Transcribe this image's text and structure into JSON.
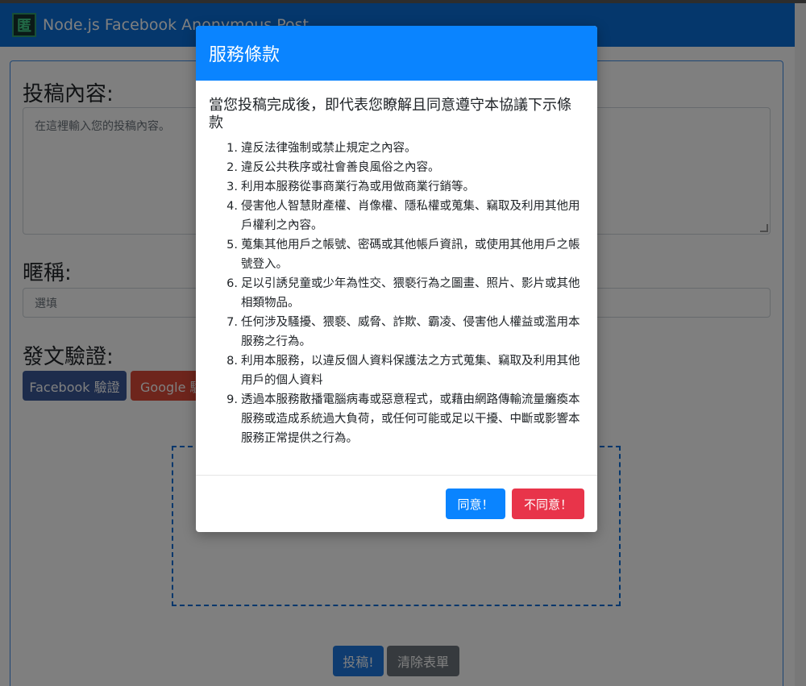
{
  "navbar": {
    "brand_icon_glyph": "匿",
    "brand": "Node.js Facebook Anonymous Post"
  },
  "form": {
    "content_label": "投稿內容:",
    "content_placeholder": "在這裡輸入您的投稿內容。",
    "nickname_label": "暱稱:",
    "nickname_placeholder": "選填",
    "verify_label": "發文驗證:",
    "facebook_button": "Facebook 驗證",
    "google_button": "Google 驗證",
    "post_button": "投稿!",
    "clear_button": "清除表單"
  },
  "modal": {
    "title": "服務條款",
    "intro": "當您投稿完成後，即代表您瞭解且同意遵守本協議下示條款",
    "terms": [
      {
        "num": "1.",
        "text": "違反法律強制或禁止規定之內容。"
      },
      {
        "num": "2.",
        "text": "違反公共秩序或社會善良風俗之內容。"
      },
      {
        "num": "3.",
        "text": "利用本服務從事商業行為或用做商業行銷等。"
      },
      {
        "num": "4.",
        "text": "侵害他人智慧財產權、肖像權、隱私權或蒐集、竊取及利用其他用戶權利之內容。"
      },
      {
        "num": "5.",
        "text": "蒐集其他用戶之帳號、密碼或其他帳戶資訊，或使用其他用戶之帳號登入。"
      },
      {
        "num": "6.",
        "text": "足以引誘兒童或少年為性交、猥褻行為之圖畫、照片、影片或其他相類物品。"
      },
      {
        "num": "7.",
        "text": "任何涉及騷擾、猥褻、威脅、詐欺、霸凌、侵害他人權益或濫用本服務之行為。"
      },
      {
        "num": "8.",
        "text": "利用本服務，以違反個人資料保護法之方式蒐集、竊取及利用其他用戶的個人資料"
      },
      {
        "num": "9.",
        "text": "透過本服務散播電腦病毒或惡意程式，或藉由網路傳輸流量癱瘓本服務或造成系統過大負荷，或任何可能或足以干擾、中斷或影響本服務正常提供之行為。"
      }
    ],
    "agree_button": "同意！",
    "disagree_button": "不同意！"
  },
  "colors": {
    "navbar": "#0a6ed8",
    "modal_header": "#0a84ff",
    "agree": "#0a84ff",
    "disagree": "#e8344a",
    "facebook": "#3b5998",
    "google": "#dc4a38",
    "clear": "#6c757d"
  }
}
